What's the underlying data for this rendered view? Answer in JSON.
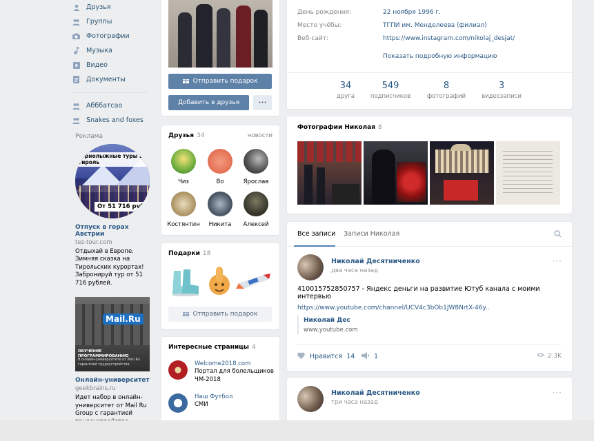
{
  "nav": {
    "items": [
      {
        "label": "Друзья",
        "icon": "friends-icon"
      },
      {
        "label": "Группы",
        "icon": "groups-icon"
      },
      {
        "label": "Фотографии",
        "icon": "camera-icon"
      },
      {
        "label": "Музыка",
        "icon": "music-icon"
      },
      {
        "label": "Видео",
        "icon": "video-icon"
      },
      {
        "label": "Документы",
        "icon": "documents-icon"
      }
    ],
    "extra": [
      {
        "label": "Абббатсао",
        "icon": "group-icon"
      },
      {
        "label": "Snakes and foxes",
        "icon": "group-icon"
      }
    ]
  },
  "ads": {
    "title": "Реклама",
    "ad1": {
      "image_header": "Горнолыжные туры в Тироль",
      "image_price": "От 51 716 руб!",
      "title": "Отпуск в горах Австрии",
      "domain": "tez-tour.com",
      "text": "Отдыхай в Европе. Зимняя сказка на Тирольских курортах! Забронируй тур от 51 716 рублей."
    },
    "ad2": {
      "image_logo": "Mail.Ru",
      "image_caption": "ОБУЧЕНИЕ ПРОГРАММИРОВАНИЮ",
      "image_subcaption": "В онлайн-университете от Mail.Ru гарантией трудоустройства",
      "title": "Онлайн-университет",
      "domain": "geekbrains.ru",
      "text": "Идет набор в онлайн-университет от Mail Ru Group с гарантией трудоустройства"
    }
  },
  "profile": {
    "send_gift_label": "Отправить подарок",
    "add_friend_label": "Добавить в друзья",
    "more_label": "•••"
  },
  "friends": {
    "title": "Друзья",
    "count": "34",
    "news_label": "новости",
    "items": [
      {
        "name": "Чиз",
        "color": "#6fae3e"
      },
      {
        "name": "Во",
        "color": "#e7765a"
      },
      {
        "name": "Ярослав",
        "color": "#333333"
      },
      {
        "name": "Костянтин",
        "color": "#b29a6a"
      },
      {
        "name": "Никита",
        "color": "#4d5a68"
      },
      {
        "name": "Алексей",
        "color": "#3a3a30"
      }
    ]
  },
  "gifts": {
    "title": "Подарки",
    "count": "18",
    "send_label": "Отправить подарок"
  },
  "pages": {
    "title": "Интересные страницы",
    "count": "4",
    "items": [
      {
        "name": "Welcome2018.com",
        "desc": "Портал для болельщиков ЧМ-2018",
        "color": "#b11f24"
      },
      {
        "name": "Наш Футбол",
        "desc": "СМИ",
        "color": "#3b6aa0"
      }
    ]
  },
  "info": {
    "rows": [
      {
        "label": "День рождения:",
        "value": "22 ноября 1996 г."
      },
      {
        "label": "Место учёбы:",
        "value": "ТГПИ им. Менделеева (филиал)"
      },
      {
        "label": "Веб-сайт:",
        "value": "https://www.instagram.com/nikolaj_desjat/"
      }
    ],
    "more_info": "Показать подробную информацию",
    "stats": [
      {
        "num": "34",
        "label": "друга"
      },
      {
        "num": "549",
        "label": "подписчиков"
      },
      {
        "num": "8",
        "label": "фотографий"
      },
      {
        "num": "3",
        "label": "видеозаписи"
      }
    ]
  },
  "photos": {
    "title": "Фотографии Николая",
    "count": "8"
  },
  "wall": {
    "tab_all": "Все записи",
    "tab_own": "Записи Николая",
    "post1": {
      "author": "Николай Десятниченко",
      "time": "два часа назад",
      "text": "410015752850757 - Яндекс деньги на развитие Ютуб канала с моими интервью",
      "link": "https://www.youtube.com/channel/UCV4c3bOb1JW8NrtX-46y..",
      "attach_title": "Николай Дес",
      "attach_domain": "www.youtube.com",
      "likes_label": "Нравится",
      "likes": "14",
      "shares": "1",
      "views": "2.3K"
    },
    "post2": {
      "author": "Николай Десятниченко",
      "time": "три часа назад"
    }
  }
}
